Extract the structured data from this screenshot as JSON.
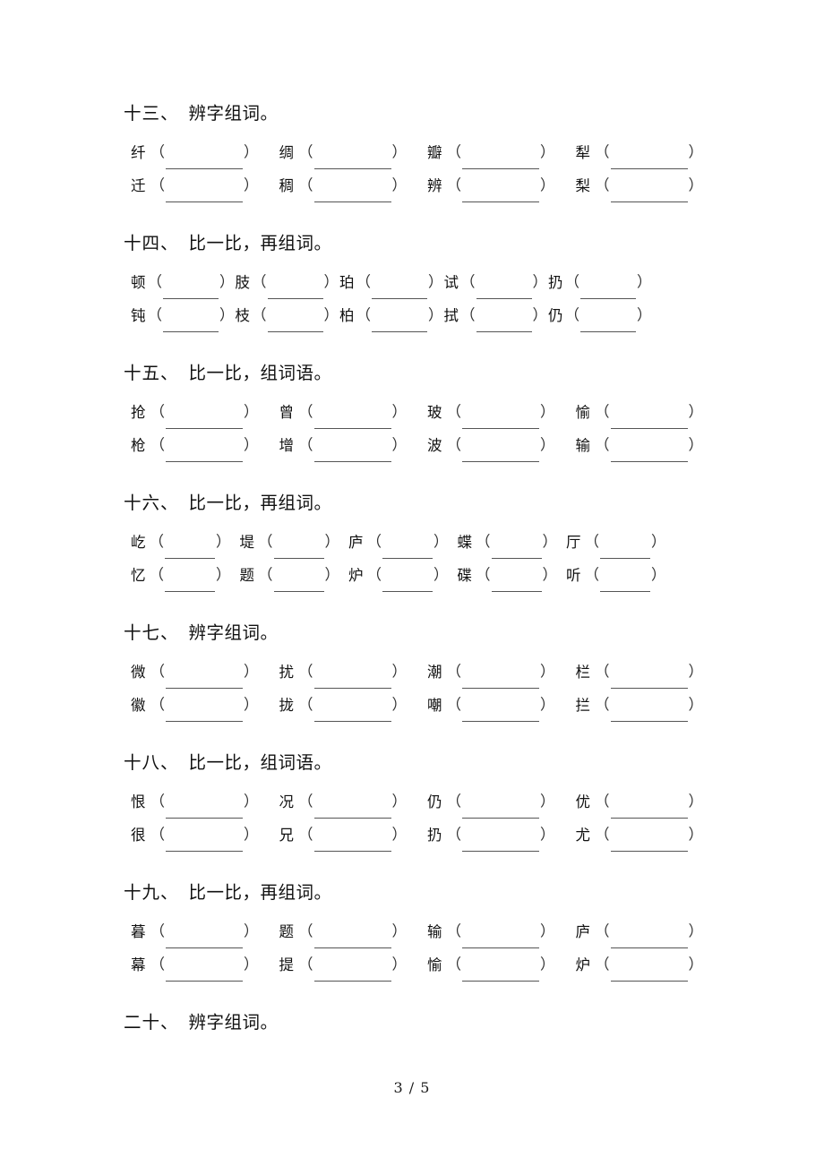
{
  "document": {
    "page_label": "3 / 5",
    "page_current": "3",
    "page_total": "5"
  },
  "sections": [
    {
      "number": "十三、",
      "title": "辨字组词。",
      "columns": 4,
      "layout": "cols4",
      "rows": [
        [
          "纤",
          "绸",
          "瓣",
          "犁"
        ],
        [
          "迁",
          "稠",
          "辨",
          "梨"
        ]
      ]
    },
    {
      "number": "十四、",
      "title": "比一比，再组词。",
      "columns": 5,
      "layout": "cols5",
      "rows": [
        [
          "顿",
          "肢",
          "珀",
          "试",
          "扔"
        ],
        [
          "钝",
          "枝",
          "柏",
          "拭",
          "仍"
        ]
      ]
    },
    {
      "number": "十五、",
      "title": "比一比，组词语。",
      "columns": 4,
      "layout": "cols4",
      "rows": [
        [
          "抢",
          "曾",
          "玻",
          "愉"
        ],
        [
          "枪",
          "增",
          "波",
          "输"
        ]
      ]
    },
    {
      "number": "十六、",
      "title": "比一比，再组词。",
      "columns": 5,
      "layout": "cols5b",
      "rows": [
        [
          "屹",
          "堤",
          "庐",
          "蝶",
          "厅"
        ],
        [
          "忆",
          "题",
          "炉",
          "碟",
          "听"
        ]
      ]
    },
    {
      "number": "十七、",
      "title": "辨字组词。",
      "columns": 4,
      "layout": "cols4",
      "rows": [
        [
          "微",
          "扰",
          "潮",
          "栏"
        ],
        [
          "徽",
          "拢",
          "嘲",
          "拦"
        ]
      ]
    },
    {
      "number": "十八、",
      "title": "比一比，组词语。",
      "columns": 4,
      "layout": "cols4",
      "rows": [
        [
          "恨",
          "况",
          "仍",
          "优"
        ],
        [
          "很",
          "兄",
          "扔",
          "尤"
        ]
      ]
    },
    {
      "number": "十九、",
      "title": "比一比，再组词。",
      "columns": 4,
      "layout": "cols4",
      "rows": [
        [
          "暮",
          "题",
          "输",
          "庐"
        ],
        [
          "幕",
          "提",
          "愉",
          "炉"
        ]
      ]
    },
    {
      "number": "二十、",
      "title": "辨字组词。",
      "columns": 0,
      "layout": "cols4",
      "rows": []
    }
  ],
  "glyphs": {
    "paren_open": "（",
    "paren_close": "）"
  }
}
